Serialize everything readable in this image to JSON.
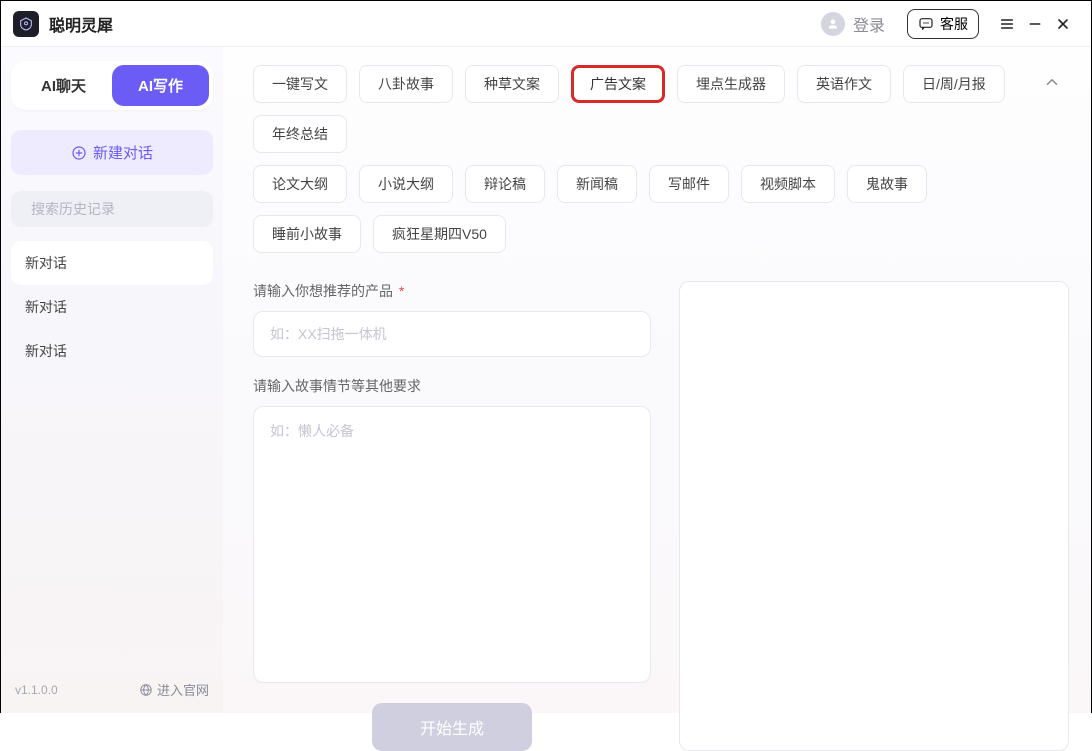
{
  "titlebar": {
    "app_name": "聪明灵犀",
    "login_label": "登录",
    "service_label": "客服"
  },
  "sidebar": {
    "tabs": {
      "chat": "AI聊天",
      "write": "AI写作",
      "active": "write"
    },
    "new_chat_label": "新建对话",
    "search_placeholder": "搜索历史记录",
    "conversations": [
      {
        "label": "新对话",
        "active": true
      },
      {
        "label": "新对话",
        "active": false
      },
      {
        "label": "新对话",
        "active": false
      }
    ],
    "version": "v1.1.0.0",
    "official_label": "进入官网"
  },
  "main": {
    "tags_row1": [
      "一键写文",
      "八卦故事",
      "种草文案",
      "广告文案",
      "埋点生成器",
      "英语作文",
      "日/周/月报",
      "年终总结"
    ],
    "tags_row2": [
      "论文大纲",
      "小说大纲",
      "辩论稿",
      "新闻稿",
      "写邮件",
      "视频脚本",
      "鬼故事",
      "睡前小故事",
      "疯狂星期四V50"
    ],
    "selected_tag": "广告文案",
    "product_label": "请输入你想推荐的产品",
    "product_placeholder": "如：XX扫拖一体机",
    "story_label": "请输入故事情节等其他要求",
    "story_placeholder": "如：懒人必备",
    "generate_label": "开始生成"
  }
}
